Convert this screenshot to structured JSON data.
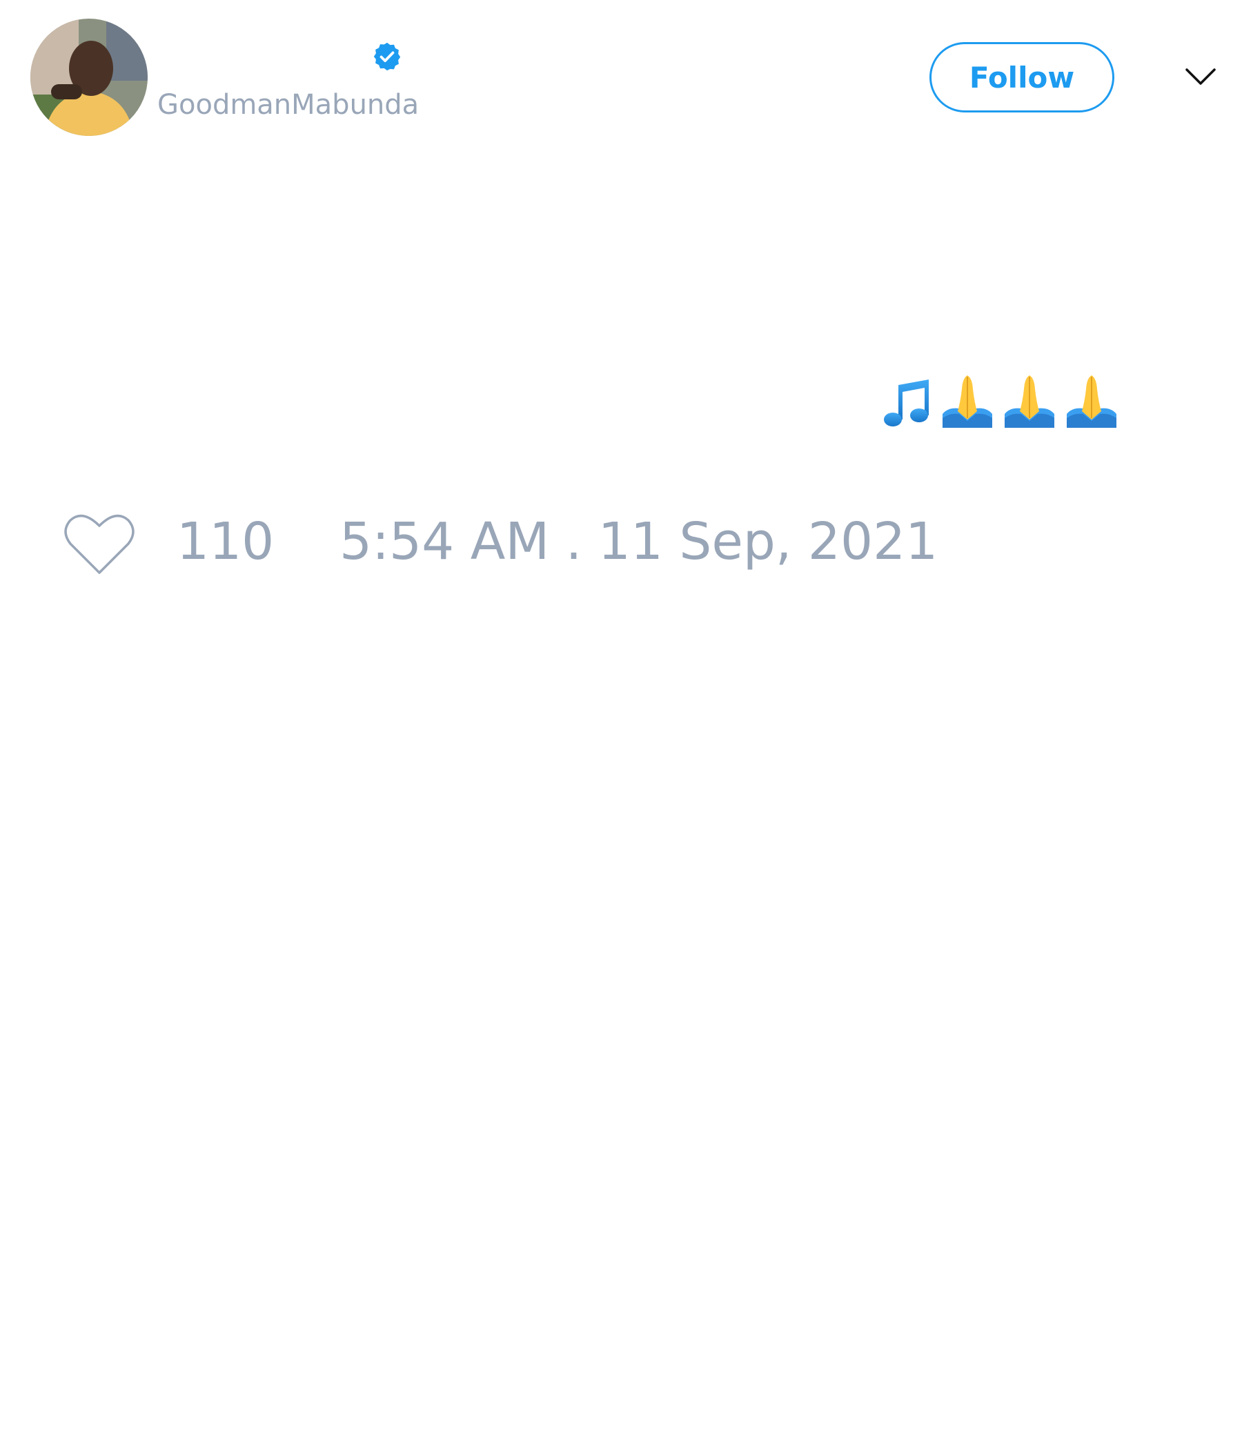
{
  "tweet": {
    "author": {
      "avatar_icon": "user-avatar-photo",
      "verified_icon": "verified-badge-icon",
      "handle": "GoodmanMabunda"
    },
    "follow_label": "Follow",
    "menu_icon": "chevron-down-icon",
    "text": "🎵🙏🙏🙏",
    "emojis": [
      "musical-note-icon",
      "folded-hands-icon",
      "folded-hands-icon",
      "folded-hands-icon"
    ],
    "likes": "110",
    "timestamp": "5:54 AM . 11 Sep, 2021"
  },
  "colors": {
    "accent": "#1d9bf0",
    "muted_text": "#99a6b8",
    "background": "#ffffff"
  }
}
